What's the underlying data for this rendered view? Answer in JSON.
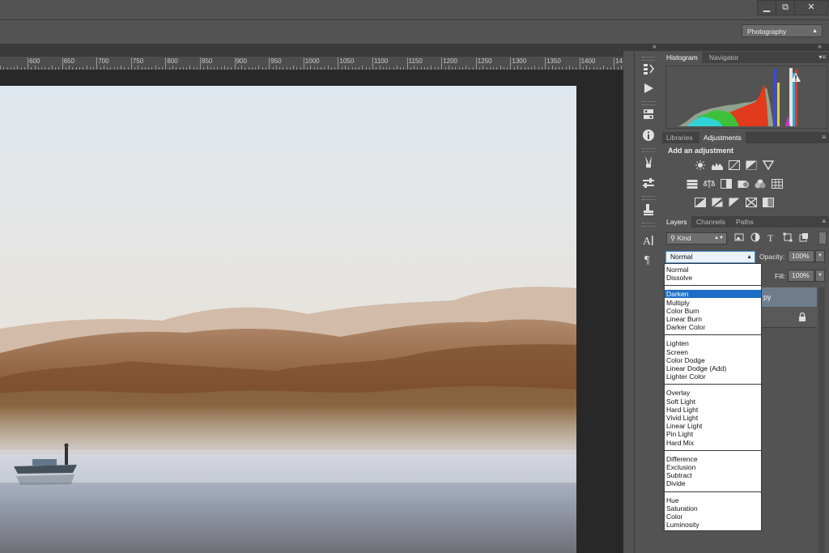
{
  "window": {
    "minimize_icon": "minimize-icon",
    "restore_icon": "restore-icon",
    "close_icon": "close-icon"
  },
  "workspace": {
    "label": "Photography"
  },
  "ruler": {
    "labels": [
      "600",
      "650",
      "700",
      "750",
      "800",
      "850",
      "900",
      "950",
      "1000",
      "1050",
      "1100",
      "1150",
      "1200",
      "1250",
      "1300",
      "1350",
      "1400",
      "14"
    ]
  },
  "panels": {
    "histogram": {
      "tabs": [
        "Histogram",
        "Navigator"
      ],
      "warning_icon": "warning-icon"
    },
    "adjustments": {
      "tabs": [
        "Libraries",
        "Adjustments"
      ],
      "heading": "Add an adjustment",
      "row1": [
        "brightness-contrast-icon",
        "levels-icon",
        "curves-icon",
        "exposure-icon",
        "vibrance-icon"
      ],
      "row2": [
        "hue-saturation-icon",
        "color-balance-icon",
        "black-white-icon",
        "photo-filter-icon",
        "channel-mixer-icon",
        "color-lookup-icon"
      ],
      "row3": [
        "invert-icon",
        "posterize-icon",
        "threshold-icon",
        "selective-color-icon",
        "gradient-map-icon"
      ]
    },
    "layers": {
      "tabs": [
        "Layers",
        "Channels",
        "Paths"
      ],
      "filter_kind": "Kind",
      "blend_mode": "Normal",
      "opacity_label": "Opacity:",
      "opacity_value": "100%",
      "fill_label": "Fill:",
      "fill_value": "100%",
      "layer_name_partial": "py"
    }
  },
  "blend_menu": {
    "groups": [
      [
        "Normal",
        "Dissolve"
      ],
      [
        "Darken",
        "Multiply",
        "Color Burn",
        "Linear Burn",
        "Darker Color"
      ],
      [
        "Lighten",
        "Screen",
        "Color Dodge",
        "Linear Dodge (Add)",
        "Lighter Color"
      ],
      [
        "Overlay",
        "Soft Light",
        "Hard Light",
        "Vivid Light",
        "Linear Light",
        "Pin Light",
        "Hard Mix"
      ],
      [
        "Difference",
        "Exclusion",
        "Subtract",
        "Divide"
      ],
      [
        "Hue",
        "Saturation",
        "Color",
        "Luminosity"
      ]
    ],
    "highlighted": "Darken"
  },
  "colors": {
    "highlight": "#1e6ec8",
    "panel_bg": "#535353",
    "canvas_bg": "#282828"
  }
}
